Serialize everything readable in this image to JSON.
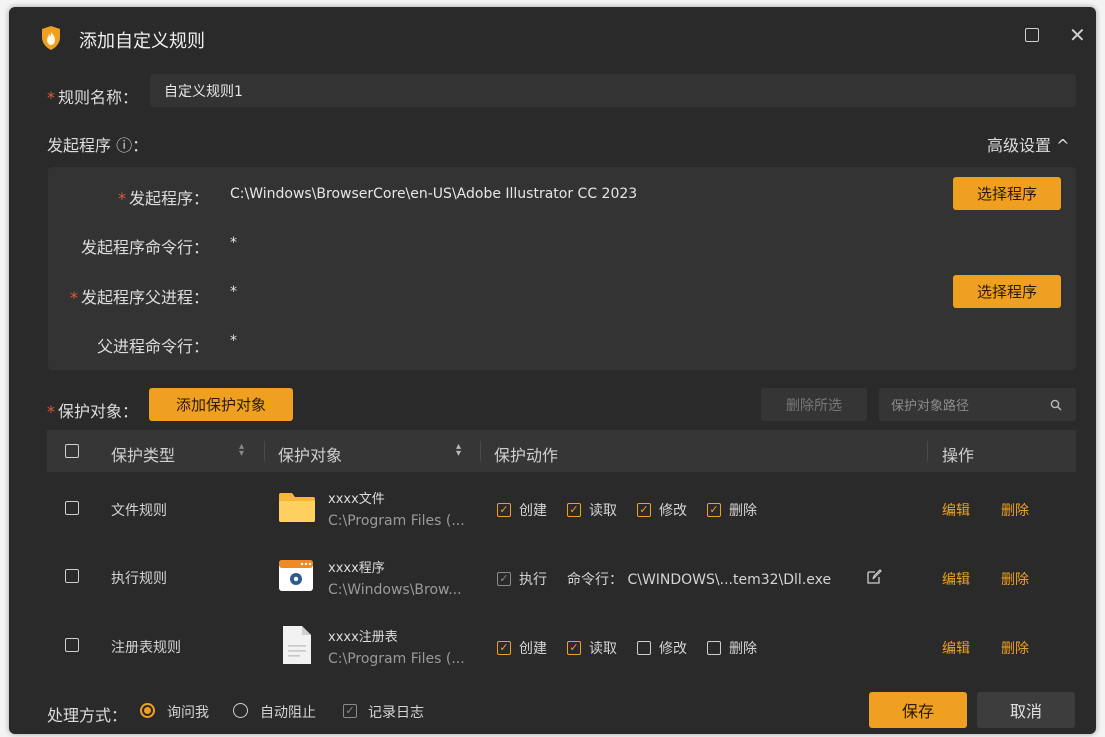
{
  "window": {
    "title": "添加自定义规则"
  },
  "rule_name": {
    "label": "规则名称：",
    "value": "自定义规则1"
  },
  "initiator": {
    "section_label": "发起程序 ⓘ：",
    "advanced_label": "高级设置 ^"
  },
  "advanced": {
    "program_label": "发起程序：",
    "program_value": "C:\\Windows\\BrowserCore\\en-US\\Adobe Illustrator CC 2023",
    "cmd_label": "发起程序命令行：",
    "cmd_value": "*",
    "parent_label": "发起程序父进程：",
    "parent_value": "*",
    "parent_cmd_label": "父进程命令行：",
    "parent_cmd_value": "*",
    "select_btn_1": "选择程序",
    "select_btn_2": "选择程序"
  },
  "protect": {
    "label": "保护对象：",
    "add_btn": "添加保护对象",
    "delete_selected": "删除所选",
    "search_placeholder": "保护对象路径"
  },
  "table": {
    "headers": {
      "type": "保护类型",
      "object": "保护对象",
      "action": "保护动作",
      "op": "操作"
    },
    "rows": [
      {
        "type": "文件规则",
        "name": "xxxx文件",
        "path": "C:\\Program Files (...",
        "actions": [
          "创建",
          "读取",
          "修改",
          "删除"
        ],
        "edit": "编辑",
        "delete": "删除"
      },
      {
        "type": "执行规则",
        "name": "xxxx程序",
        "path": "C:\\Windows\\Brow...",
        "actions": [
          "执行"
        ],
        "cmdline": "命令行： C\\WINDOWS\\...tem32\\Dll.exe",
        "edit": "编辑",
        "delete": "删除"
      },
      {
        "type": "注册表规则",
        "name": "xxxx注册表",
        "path": "C:\\Program Files (...",
        "actions": [
          "创建",
          "读取",
          "修改",
          "删除"
        ],
        "edit": "编辑",
        "delete": "删除"
      }
    ]
  },
  "footer": {
    "mode_label": "处理方式：",
    "opt_ask": "询问我",
    "opt_block": "自动阻止",
    "opt_log": "记录日志",
    "save": "保存",
    "cancel": "取消"
  },
  "colors": {
    "accent": "#f0a020",
    "bg": "#2a2a2a",
    "required": "#e05a3a"
  }
}
